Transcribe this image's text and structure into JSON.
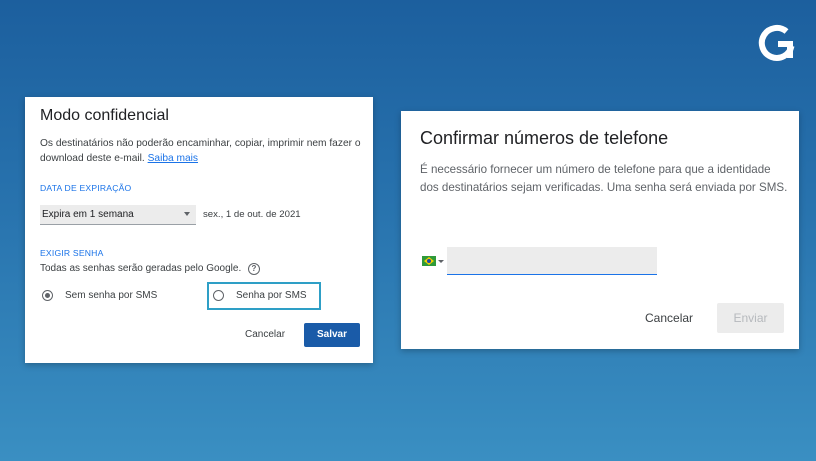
{
  "brand": {
    "logo_icon": "g-circle-logo-icon",
    "color": "#ffffff"
  },
  "confidential_dialog": {
    "title": "Modo confidencial",
    "description": "Os destinatários não poderão encaminhar, copiar, imprimir nem fazer o download deste e-mail.",
    "learn_more_link": "Saiba mais",
    "expiration": {
      "label": "DATA DE EXPIRAÇÃO",
      "selected_option": "Expira em 1 semana",
      "date_text": "sex., 1 de out. de 2021"
    },
    "password": {
      "label": "EXIGIR SENHA",
      "note": "Todas as senhas serão geradas pelo Google.",
      "help_icon": "question-circle-icon",
      "options": [
        {
          "label": "Sem senha por SMS",
          "selected": true
        },
        {
          "label": "Senha por SMS",
          "selected": false
        }
      ]
    },
    "cancel_label": "Cancelar",
    "save_label": "Salvar",
    "accent_color": "#1a73e8",
    "save_color": "#1a5ba8",
    "highlight_color": "#2e9fc6"
  },
  "phone_dialog": {
    "title": "Confirmar números de telefone",
    "description": "É necessário fornecer um número de telefone para que a identidade dos destinatários sejam verificadas. Uma senha será enviada por SMS.",
    "country_flag": "brazil-flag-icon",
    "phone_value": "",
    "cancel_label": "Cancelar",
    "send_label": "Enviar"
  }
}
